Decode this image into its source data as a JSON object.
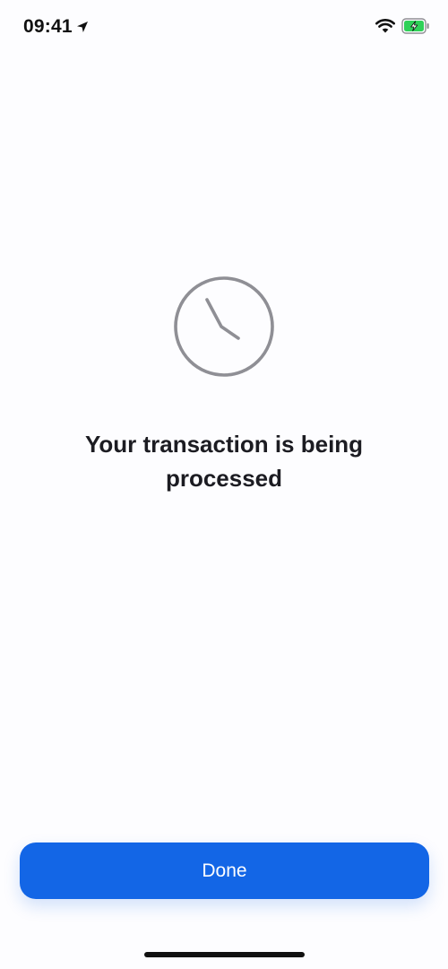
{
  "status_bar": {
    "time": "09:41",
    "icons": [
      "location-arrow-icon",
      "wifi-icon",
      "battery-charging-icon"
    ],
    "battery_color": "#2fd158"
  },
  "main": {
    "status_icon": "clock-icon",
    "message": "Your transaction is being processed"
  },
  "footer": {
    "done_label": "Done",
    "accent_color": "#1366e6"
  }
}
